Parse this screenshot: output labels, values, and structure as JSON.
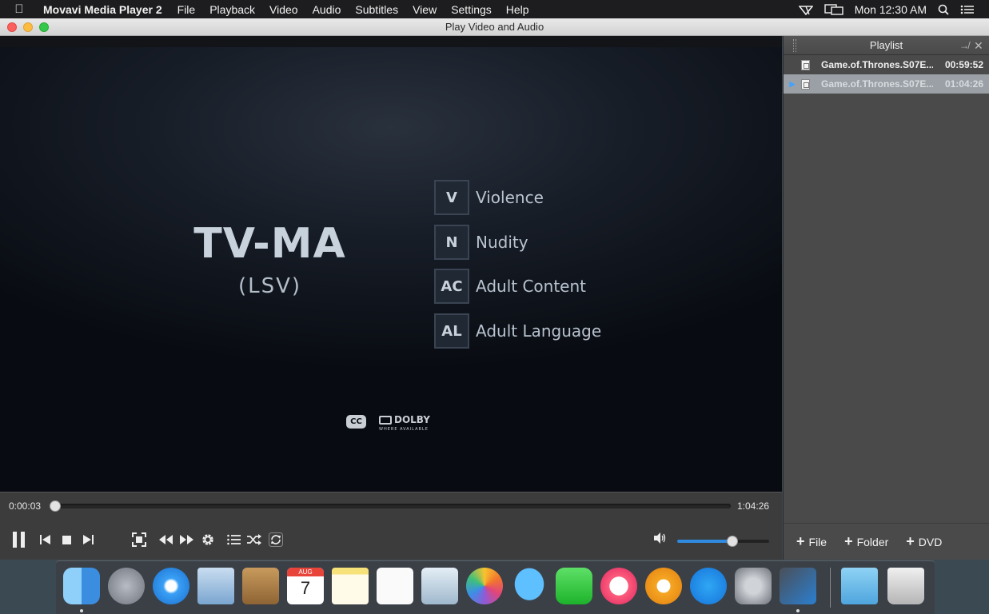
{
  "menubar": {
    "app_name": "Movavi Media Player 2",
    "menus": [
      "File",
      "Playback",
      "Video",
      "Audio",
      "Subtitles",
      "View",
      "Settings",
      "Help"
    ],
    "clock": "Mon 12:30 AM"
  },
  "window": {
    "title": "Play Video and Audio"
  },
  "video": {
    "rating": "TV-MA",
    "rating_sub": "(LSV)",
    "descriptors": [
      {
        "code": "V",
        "label": "Violence"
      },
      {
        "code": "N",
        "label": "Nudity"
      },
      {
        "code": "AC",
        "label": "Adult Content"
      },
      {
        "code": "AL",
        "label": "Adult Language"
      }
    ],
    "cc_logo": "CC",
    "dolby": "DOLBY",
    "dolby_sub": "WHERE AVAILABLE"
  },
  "controls": {
    "current_time": "0:00:03",
    "total_time": "1:04:26",
    "progress_fraction": 0.0008,
    "volume_fraction": 0.6
  },
  "playlist": {
    "title": "Playlist",
    "items": [
      {
        "name": "Game.of.Thrones.S07E...",
        "duration": "00:59:52"
      },
      {
        "name": "Game.of.Thrones.S07E...",
        "duration": "01:04:26"
      }
    ],
    "add_file": "File",
    "add_folder": "Folder",
    "add_dvd": "DVD"
  },
  "dock": {
    "apps": [
      "finder",
      "launchpad",
      "safari",
      "mail",
      "contacts",
      "calendar",
      "notes",
      "reminders",
      "preview",
      "photos",
      "messages",
      "facetime",
      "itunes",
      "ibooks",
      "app-store",
      "system-preferences",
      "movavi",
      "downloads",
      "trash"
    ],
    "calendar_month": "AUG",
    "calendar_day": "7"
  }
}
